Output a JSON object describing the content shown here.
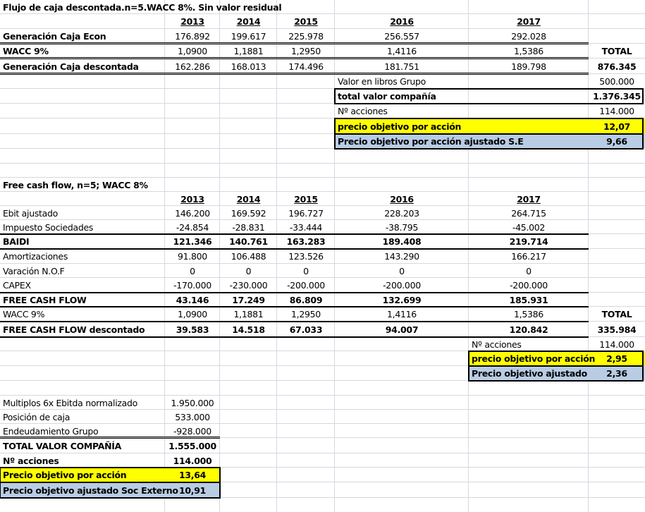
{
  "colors": {
    "yellow": "#ffff00",
    "blue": "#b8cce4",
    "grid": "#d4d8e0"
  },
  "dcf": {
    "title": "Flujo de caja descontada.n=5.WACC 8%. Sin valor residual",
    "years": [
      "2013",
      "2014",
      "2015",
      "2016",
      "2017"
    ],
    "rows": [
      {
        "label": "Generación Caja Econ",
        "values": [
          "176.892",
          "199.617",
          "225.978",
          "256.557",
          "292.028"
        ]
      },
      {
        "label": "WACC 9%",
        "values": [
          "1,0900",
          "1,1881",
          "1,2950",
          "1,4116",
          "1,5386"
        ],
        "total": "TOTAL"
      },
      {
        "label": "Generación Caja descontada",
        "values": [
          "162.286",
          "168.013",
          "174.496",
          "181.751",
          "189.798"
        ],
        "total": "876.345"
      }
    ],
    "summary": [
      {
        "label": "Valor en libros Grupo",
        "value": "500.000"
      },
      {
        "label": "total valor compañía",
        "value": "1.376.345"
      },
      {
        "label": "Nº acciones",
        "value": "114.000"
      },
      {
        "label": "precio objetivo por acción",
        "value": "12,07"
      },
      {
        "label": "Precio objetivo por acción ajustado S.E",
        "value": "9,66"
      }
    ]
  },
  "fcf": {
    "title": "Free cash flow, n=5; WACC 8%",
    "years": [
      "2013",
      "2014",
      "2015",
      "2016",
      "2017"
    ],
    "rows": [
      {
        "label": "Ebit ajustado",
        "values": [
          "146.200",
          "169.592",
          "196.727",
          "228.203",
          "264.715"
        ]
      },
      {
        "label": "Impuesto Sociedades",
        "values": [
          "-24.854",
          "-28.831",
          "-33.444",
          "-38.795",
          "-45.002"
        ]
      },
      {
        "label": "BAIDI",
        "values": [
          "121.346",
          "140.761",
          "163.283",
          "189.408",
          "219.714"
        ]
      },
      {
        "label": "Amortizaciones",
        "values": [
          "91.800",
          "106.488",
          "123.526",
          "143.290",
          "166.217"
        ]
      },
      {
        "label": "Varación N.O.F",
        "values": [
          "0",
          "0",
          "0",
          "0",
          "0"
        ]
      },
      {
        "label": "CAPEX",
        "values": [
          "-170.000",
          "-230.000",
          "-200.000",
          "-200.000",
          "-200.000"
        ]
      },
      {
        "label": "FREE CASH FLOW",
        "values": [
          "43.146",
          "17.249",
          "86.809",
          "132.699",
          "185.931"
        ]
      },
      {
        "label": "WACC 9%",
        "values": [
          "1,0900",
          "1,1881",
          "1,2950",
          "1,4116",
          "1,5386"
        ],
        "total": "TOTAL"
      },
      {
        "label": "FREE CASH FLOW descontado",
        "values": [
          "39.583",
          "14.518",
          "67.033",
          "94.007",
          "120.842"
        ],
        "total": "335.984"
      }
    ],
    "summary": [
      {
        "label": "Nº acciones",
        "value": "114.000"
      },
      {
        "label": "precio objetivo por acción",
        "value": "2,95"
      },
      {
        "label": "Precio objetivo ajustado",
        "value": "2,36"
      }
    ]
  },
  "multiples": {
    "rows": [
      {
        "label": "Multiplos 6x Ebitda normalizado",
        "value": "1.950.000"
      },
      {
        "label": "Posición de caja",
        "value": "533.000"
      },
      {
        "label": "Endeudamiento Grupo",
        "value": "-928.000"
      },
      {
        "label": "TOTAL VALOR COMPAÑÍA",
        "value": "1.555.000"
      },
      {
        "label": "Nº acciones",
        "value": "114.000"
      },
      {
        "label": "Precio objetivo por acción",
        "value": "13,64"
      },
      {
        "label": "Precio objetivo ajustado Soc Externo",
        "value": "10,91"
      }
    ]
  }
}
